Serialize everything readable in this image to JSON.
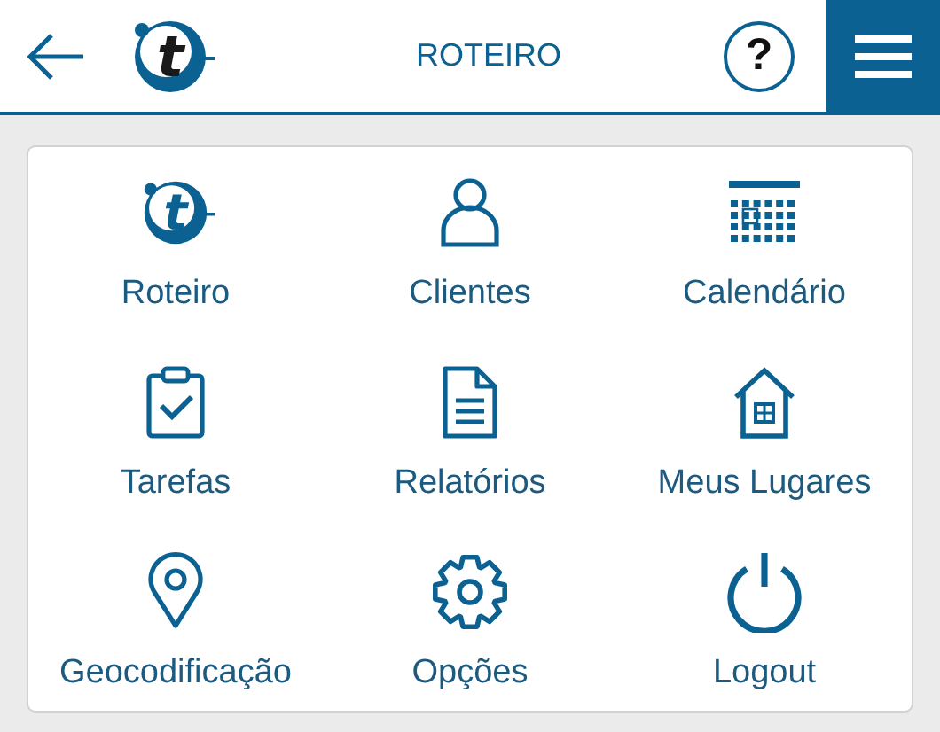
{
  "header": {
    "title": "ROTEIRO",
    "logo_letter": "t",
    "help": "?"
  },
  "menu_items": [
    {
      "label": "Roteiro",
      "kind": "logo",
      "letter": "t"
    },
    {
      "label": "Clientes",
      "kind": "person"
    },
    {
      "label": "Calendário",
      "kind": "calendar"
    },
    {
      "label": "Tarefas",
      "kind": "clipboard"
    },
    {
      "label": "Relatórios",
      "kind": "document"
    },
    {
      "label": "Meus Lugares",
      "kind": "house"
    },
    {
      "label": "Geocodificação",
      "kind": "pin"
    },
    {
      "label": "Opções",
      "kind": "gear"
    },
    {
      "label": "Logout",
      "kind": "power"
    }
  ]
}
